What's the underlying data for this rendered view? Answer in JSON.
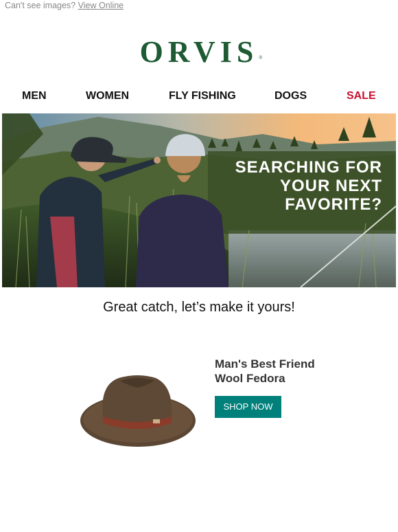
{
  "preheader": {
    "text": "Can't see images?",
    "link": "View Online"
  },
  "logo": {
    "text": "ORVIS",
    "reg": "®"
  },
  "nav": {
    "items": [
      {
        "label": "MEN"
      },
      {
        "label": "WOMEN"
      },
      {
        "label": "FLY FISHING"
      },
      {
        "label": "DOGS"
      },
      {
        "label": "SALE"
      }
    ],
    "sale_color": "#c8102e"
  },
  "hero": {
    "lines": [
      "SEARCHING FOR",
      "YOUR NEXT",
      "FAVORITE?"
    ]
  },
  "tagline": "Great catch, let’s make it yours!",
  "product": {
    "name_line1": "Man's Best Friend",
    "name_line2": "Wool Fedora",
    "button": "SHOP NOW",
    "button_color": "#00807b",
    "image_icon": "wool-fedora-hat-image"
  },
  "colors": {
    "brand": "#1e5a32"
  }
}
